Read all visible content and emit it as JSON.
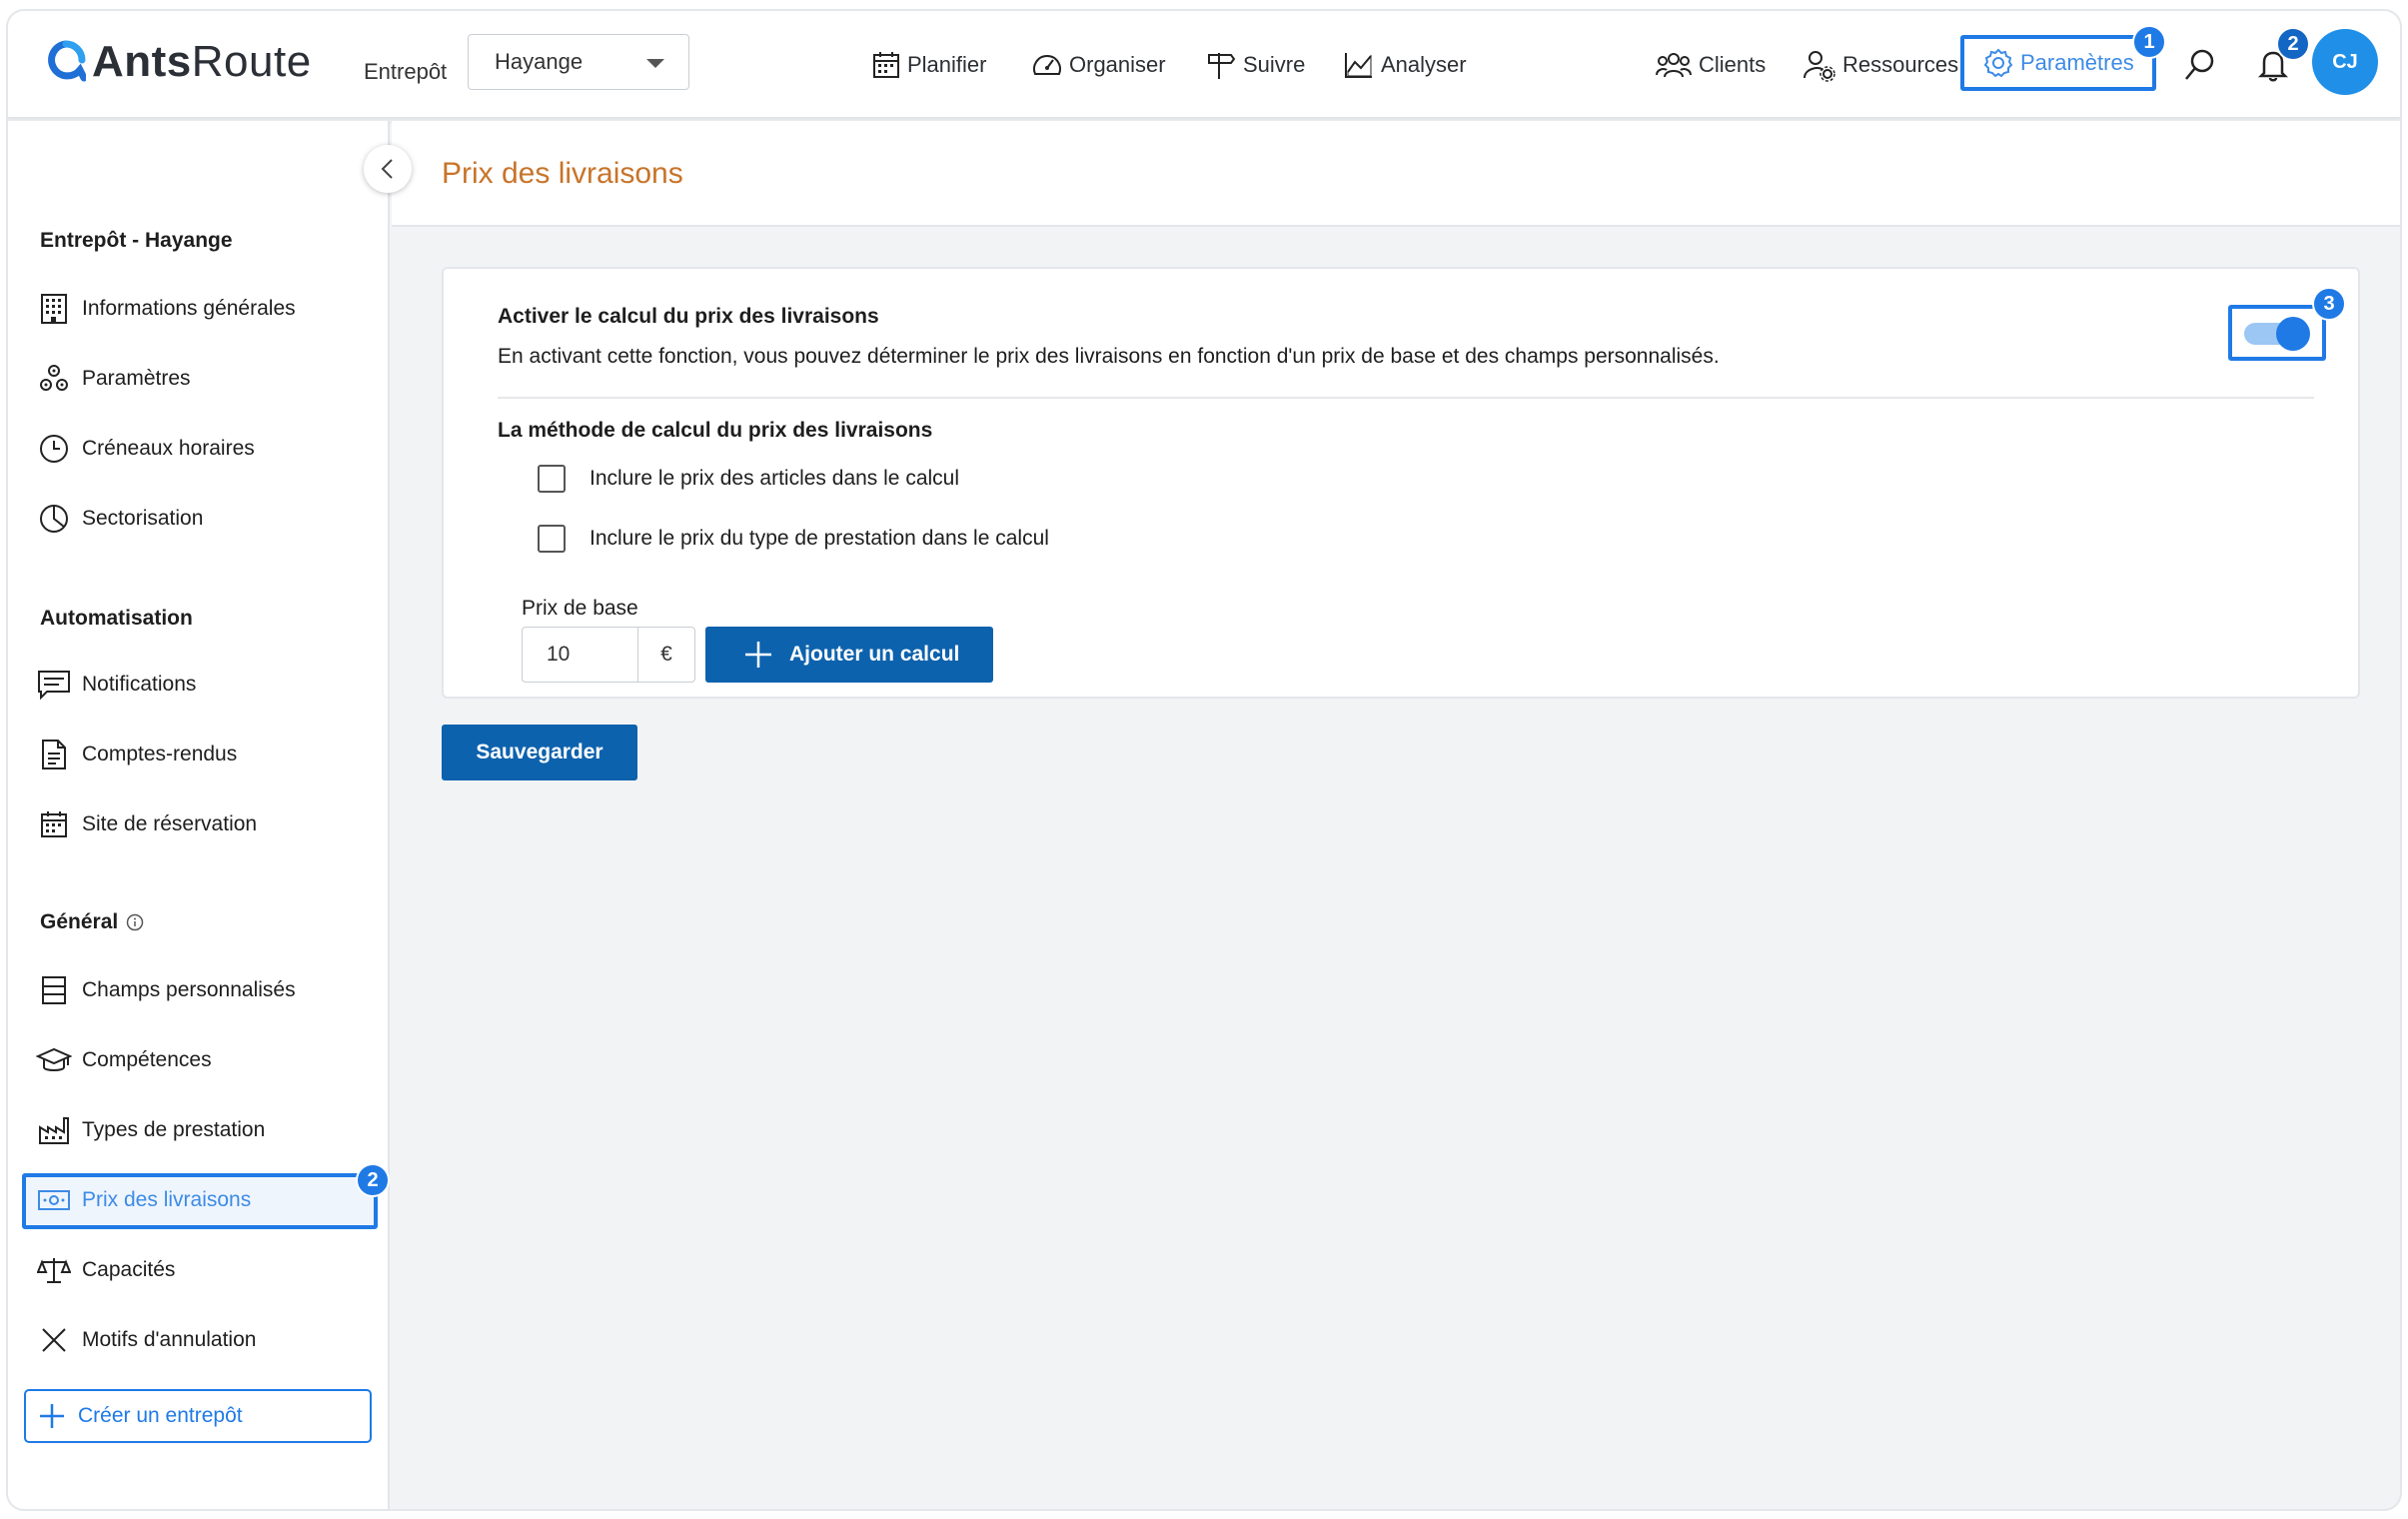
{
  "header": {
    "logo_text_bold": "Ants",
    "logo_text_rest": "Route",
    "warehouse_label": "Entrepôt",
    "warehouse_value": "Hayange",
    "nav": [
      {
        "label": "Planifier",
        "icon": "calendar-icon"
      },
      {
        "label": "Organiser",
        "icon": "gauge-icon"
      },
      {
        "label": "Suivre",
        "icon": "signpost-icon"
      },
      {
        "label": "Analyser",
        "icon": "chart-icon"
      },
      {
        "label": "Clients",
        "icon": "users-icon"
      },
      {
        "label": "Ressources",
        "icon": "user-gear-icon"
      },
      {
        "label": "Paramètres",
        "icon": "gear-icon"
      }
    ],
    "badge_params": "1",
    "badge_notifications": "2",
    "avatar_initials": "CJ"
  },
  "sidebar": {
    "section_warehouse": "Entrepôt - Hayange",
    "warehouse_items": [
      {
        "label": "Informations générales"
      },
      {
        "label": "Paramètres"
      },
      {
        "label": "Créneaux horaires"
      },
      {
        "label": "Sectorisation"
      }
    ],
    "section_automation": "Automatisation",
    "automation_items": [
      {
        "label": "Notifications"
      },
      {
        "label": "Comptes-rendus"
      },
      {
        "label": "Site de réservation"
      }
    ],
    "section_general": "Général",
    "general_items": [
      {
        "label": "Champs personnalisés"
      },
      {
        "label": "Compétences"
      },
      {
        "label": "Types de prestation"
      },
      {
        "label": "Prix des livraisons"
      },
      {
        "label": "Capacités"
      },
      {
        "label": "Motifs d'annulation"
      }
    ],
    "badge_active": "2",
    "create_label": "Créer un entrepôt"
  },
  "main": {
    "page_title": "Prix des livraisons",
    "card": {
      "title": "Activer le calcul du prix des livraisons",
      "description": "En activant cette fonction, vous pouvez déterminer le prix des livraisons en fonction d'un prix de base et des champs personnalisés.",
      "toggle_on": true,
      "badge_toggle": "3",
      "method_title": "La méthode de calcul du prix des livraisons",
      "checkbox_articles": "Inclure le prix des articles dans le calcul",
      "checkbox_prestation": "Inclure le prix du type de prestation dans le calcul",
      "base_price_label": "Prix de base",
      "base_price_value": "10",
      "currency": "€",
      "add_calc_label": "Ajouter un calcul"
    },
    "save_label": "Sauvegarder"
  },
  "colors": {
    "accent": "#1f7ae6",
    "primary_button": "#0d62ad",
    "title_orange": "#c8742a"
  }
}
